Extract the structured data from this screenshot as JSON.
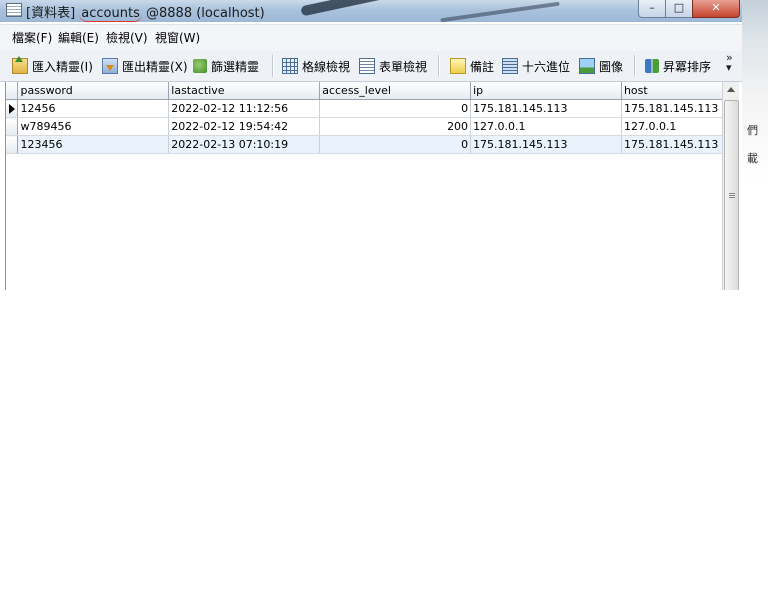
{
  "title": {
    "prefix": "[資料表]",
    "table_name": "accounts",
    "suffix": "@8888 (localhost)"
  },
  "window_buttons": {
    "minimize": "–",
    "maximize": "□",
    "close": "✕"
  },
  "menu": [
    {
      "label": "檔案(F)"
    },
    {
      "label": "編輯(E)"
    },
    {
      "label": "檢視(V)"
    },
    {
      "label": "視窗(W)"
    }
  ],
  "toolbar": {
    "import_label": "匯入精靈(I)",
    "export_label": "匯出精靈(X)",
    "filter_label": "篩選精靈",
    "grid_view_label": "格線檢視",
    "form_view_label": "表單檢視",
    "memo_label": "備註",
    "hex_label": "十六進位",
    "image_label": "圖像",
    "sort_asc_label": "昇冪排序",
    "more_label": "»"
  },
  "grid": {
    "columns": [
      "password",
      "lastactive",
      "access_level",
      "ip",
      "host"
    ],
    "rows": [
      {
        "password": "12456",
        "lastactive": "2022-02-12 11:12:56",
        "access_level": "0",
        "ip": "175.181.145.113",
        "host": "175.181.145.113"
      },
      {
        "password": "w789456",
        "lastactive": "2022-02-12 19:54:42",
        "access_level": "200",
        "ip": "127.0.0.1",
        "host": "127.0.0.1"
      },
      {
        "password": "123456",
        "lastactive": "2022-02-13 07:10:19",
        "access_level": "0",
        "ip": "175.181.145.113",
        "host": "175.181.145.113"
      }
    ]
  },
  "right_strip": {
    "char1": "們",
    "char2": "載"
  },
  "colors": {
    "titlebar": "#aac2dc",
    "close_button": "#c5442e",
    "selected_row": "#eaf2fb"
  }
}
